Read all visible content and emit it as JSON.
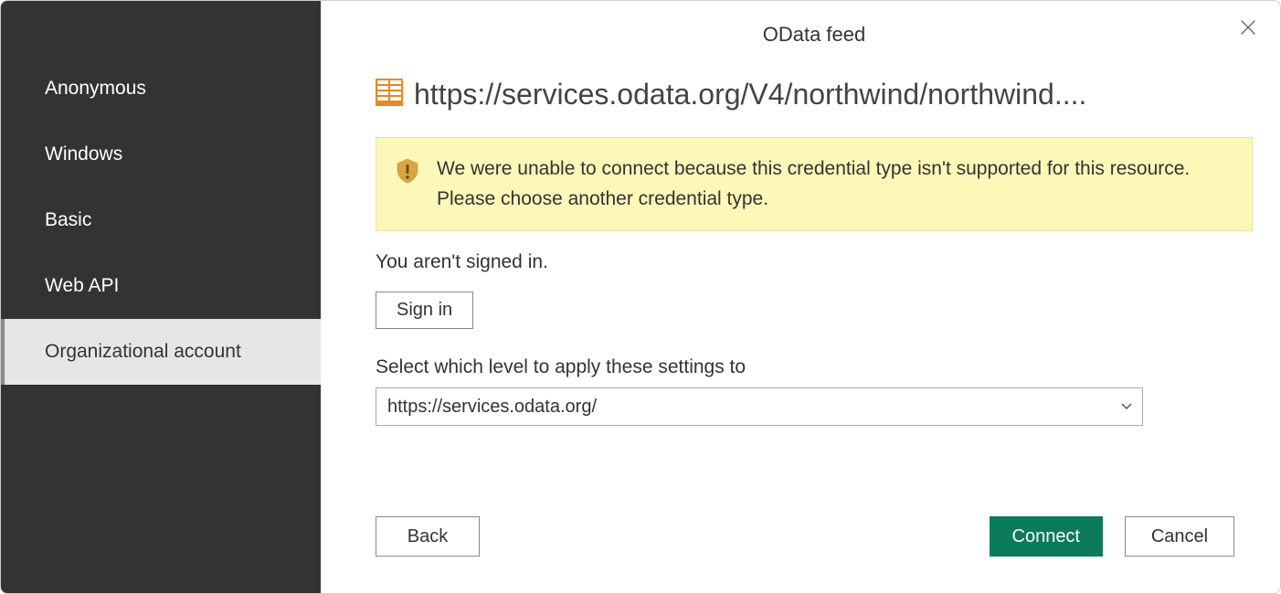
{
  "dialog": {
    "title": "OData feed"
  },
  "sidebar": {
    "items": [
      {
        "label": "Anonymous",
        "selected": false
      },
      {
        "label": "Windows",
        "selected": false
      },
      {
        "label": "Basic",
        "selected": false
      },
      {
        "label": "Web API",
        "selected": false
      },
      {
        "label": "Organizational account",
        "selected": true
      }
    ]
  },
  "main": {
    "url": "https://services.odata.org/V4/northwind/northwind....",
    "warning": "We were unable to connect because this credential type isn't supported for this resource. Please choose another credential type.",
    "status_text": "You aren't signed in.",
    "signin_label": "Sign in",
    "level_label": "Select which level to apply these settings to",
    "level_value": "https://services.odata.org/"
  },
  "footer": {
    "back_label": "Back",
    "connect_label": "Connect",
    "cancel_label": "Cancel"
  },
  "colors": {
    "sidebar_bg": "#333333",
    "warning_bg": "#fdf7b8",
    "primary": "#0c7b5b"
  }
}
